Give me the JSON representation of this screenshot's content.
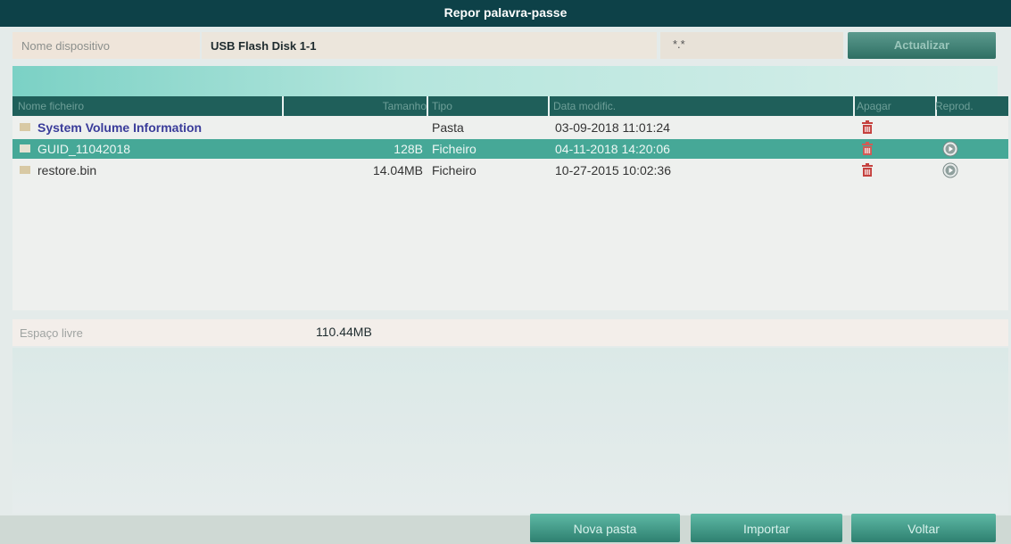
{
  "window": {
    "title": "Repor palavra-passe"
  },
  "device": {
    "label": "Nome dispositivo",
    "value": "USB Flash Disk 1-1",
    "filter": "*.*",
    "refresh_label": "Actualizar"
  },
  "table": {
    "headers": {
      "name": "Nome ficheiro",
      "size": "Tamanho",
      "type": "Tipo",
      "date": "Data modific.",
      "delete": "Apagar",
      "play": "Reprod."
    },
    "rows": [
      {
        "name": "System Volume Information",
        "size": "",
        "type": "Pasta",
        "date": "03-09-2018 11:01:24",
        "delete_icon": "trash-icon",
        "play_icon": ""
      },
      {
        "name": "GUID_11042018",
        "size": "128B",
        "type": "Ficheiro",
        "date": "04-11-2018 14:20:06",
        "delete_icon": "trash-icon",
        "play_icon": "play-icon"
      },
      {
        "name": "restore.bin",
        "size": "14.04MB",
        "type": "Ficheiro",
        "date": "10-27-2015 10:02:36",
        "delete_icon": "trash-icon",
        "play_icon": "play-icon"
      }
    ],
    "selected_index": 1
  },
  "free_space": {
    "label": "Espaço livre",
    "value": "110.44MB"
  },
  "footer": {
    "new_folder_label": "Nova pasta",
    "import_label": "Importar",
    "back_label": "Voltar"
  },
  "colors": {
    "title_bar": "#0d4148",
    "selected_row": "#46a897",
    "button": "#3f9886",
    "trash_icon": "#c5413e"
  }
}
